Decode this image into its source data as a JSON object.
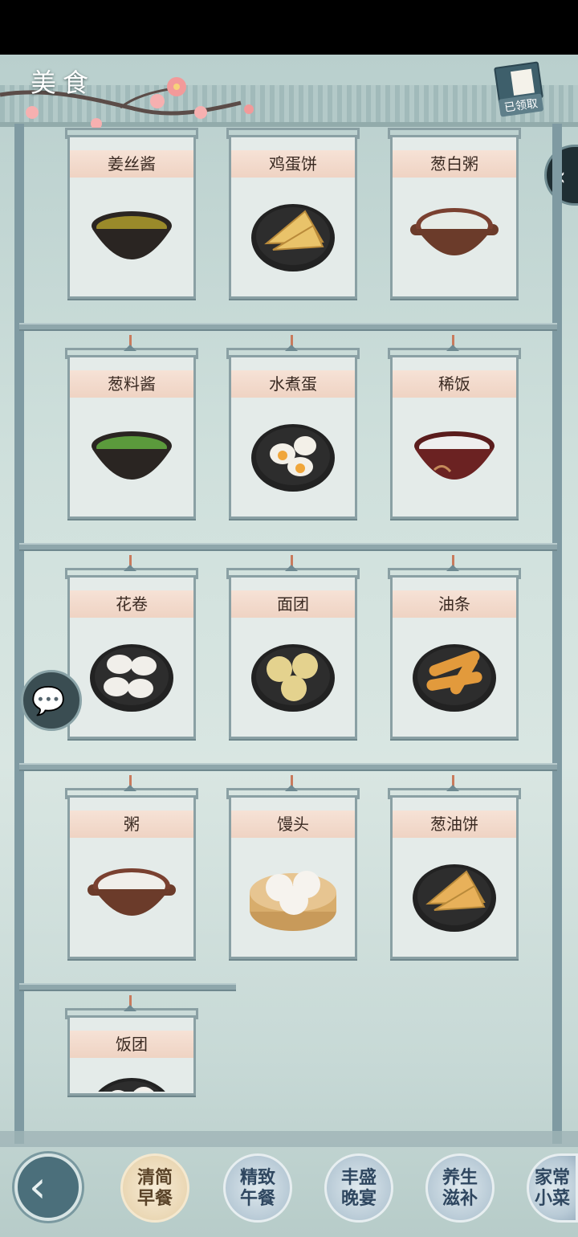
{
  "header": {
    "title": "美食",
    "claim_label": "已领取"
  },
  "icons": {
    "side_tab": "chevron-left-icon",
    "chat": "chat-bubble-icon",
    "back": "back-arrow-icon"
  },
  "side_tab_glyph": "‹",
  "back_glyph": "‹",
  "chat_glyph": "💬",
  "dishes": [
    {
      "name": "姜丝酱",
      "kind": "bowl",
      "fill": "#9a8a2a"
    },
    {
      "name": "鸡蛋饼",
      "kind": "plate-triangle",
      "fill": "#e9c36a"
    },
    {
      "name": "葱白粥",
      "kind": "pot",
      "fill": "#e6ebe6"
    },
    {
      "name": "葱料酱",
      "kind": "bowl",
      "fill": "#5b9a3c"
    },
    {
      "name": "水煮蛋",
      "kind": "plate-eggs",
      "fill": "#f3f0e8"
    },
    {
      "name": "稀饭",
      "kind": "bowl-red",
      "fill": "#eeeeee"
    },
    {
      "name": "花卷",
      "kind": "plate-rolls",
      "fill": "#f1efea"
    },
    {
      "name": "面团",
      "kind": "plate-balls",
      "fill": "#e4d28e"
    },
    {
      "name": "油条",
      "kind": "plate-sticks",
      "fill": "#e29a3c"
    },
    {
      "name": "粥",
      "kind": "pot",
      "fill": "#f0eeea"
    },
    {
      "name": "馒头",
      "kind": "steamer",
      "fill": "#f6f3ee"
    },
    {
      "name": "葱油饼",
      "kind": "plate-triangle",
      "fill": "#e8b15a"
    },
    {
      "name": "饭团",
      "kind": "plate-balls",
      "fill": "#f1efea"
    }
  ],
  "categories": [
    {
      "label": "清简早餐",
      "active": true
    },
    {
      "label": "精致午餐",
      "active": false
    },
    {
      "label": "丰盛晚宴",
      "active": false
    },
    {
      "label": "养生滋补",
      "active": false
    },
    {
      "label": "家常小菜",
      "active": false
    }
  ]
}
